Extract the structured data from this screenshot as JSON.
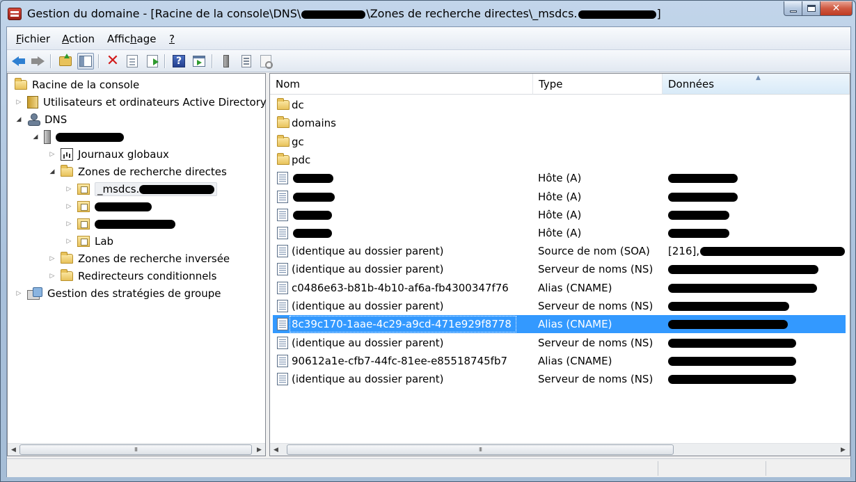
{
  "window": {
    "title_prefix": "Gestion du domaine - [Racine de la console\\DNS\\",
    "title_middle": "\\Zones de recherche directes\\_msdcs.",
    "title_suffix": "]",
    "buttons": {
      "minimize": "minimize",
      "maximize": "maximize",
      "close": "✕"
    }
  },
  "menu": [
    {
      "accel": "F",
      "rest": "ichier"
    },
    {
      "accel": "A",
      "rest": "ction"
    },
    {
      "pre": "Affic",
      "accel": "h",
      "rest": "age"
    },
    {
      "accel": "?",
      "rest": ""
    }
  ],
  "toolbar_icons": [
    "back-arrow-icon",
    "forward-arrow-icon",
    "folder-up-icon",
    "show-hide-tree-icon",
    "delete-icon",
    "properties-doc-icon",
    "export-list-icon",
    "help-icon",
    "show-action-pane-icon",
    "server-icon",
    "list-icon",
    "list-settings-icon"
  ],
  "tree": {
    "root": "Racine de la console",
    "ad_users": "Utilisateurs et ordinateurs Active Directory",
    "dns": "DNS",
    "global_logs": "Journaux globaux",
    "forward_zones": "Zones de recherche directes",
    "msdcs_prefix": "_msdcs.",
    "lab": "Lab",
    "reverse_zones": "Zones de recherche inversée",
    "conditional_forwarders": "Redirecteurs conditionnels",
    "gpo": "Gestion des stratégies de groupe"
  },
  "list": {
    "columns": [
      "Nom",
      "Type",
      "Données"
    ],
    "folders": [
      "dc",
      "domains",
      "gc",
      "pdc"
    ],
    "records": [
      {
        "name": "",
        "type": "Hôte (A)",
        "data": ""
      },
      {
        "name": "",
        "type": "Hôte (A)",
        "data": ""
      },
      {
        "name": "",
        "type": "Hôte (A)",
        "data": ""
      },
      {
        "name": "",
        "type": "Hôte (A)",
        "data": ""
      },
      {
        "name": "(identique au dossier parent)",
        "type": "Source de nom (SOA)",
        "data": "[216],"
      },
      {
        "name": "(identique au dossier parent)",
        "type": "Serveur de noms (NS)",
        "data": ""
      },
      {
        "name": "c0486e63-b81b-4b10-af6a-fb4300347f76",
        "type": "Alias (CNAME)",
        "data": ""
      },
      {
        "name": "(identique au dossier parent)",
        "type": "Serveur de noms (NS)",
        "data": ""
      },
      {
        "name": "8c39c170-1aae-4c29-a9cd-471e929f8778",
        "type": "Alias (CNAME)",
        "data": ""
      },
      {
        "name": "(identique au dossier parent)",
        "type": "Serveur de noms (NS)",
        "data": ""
      },
      {
        "name": "90612a1e-cfb7-44fc-81ee-e85518745fb7",
        "type": "Alias (CNAME)",
        "data": ""
      },
      {
        "name": "(identique au dossier parent)",
        "type": "Serveur de noms (NS)",
        "data": ""
      }
    ]
  },
  "scrollbar": {
    "thumb_grip": "III"
  }
}
